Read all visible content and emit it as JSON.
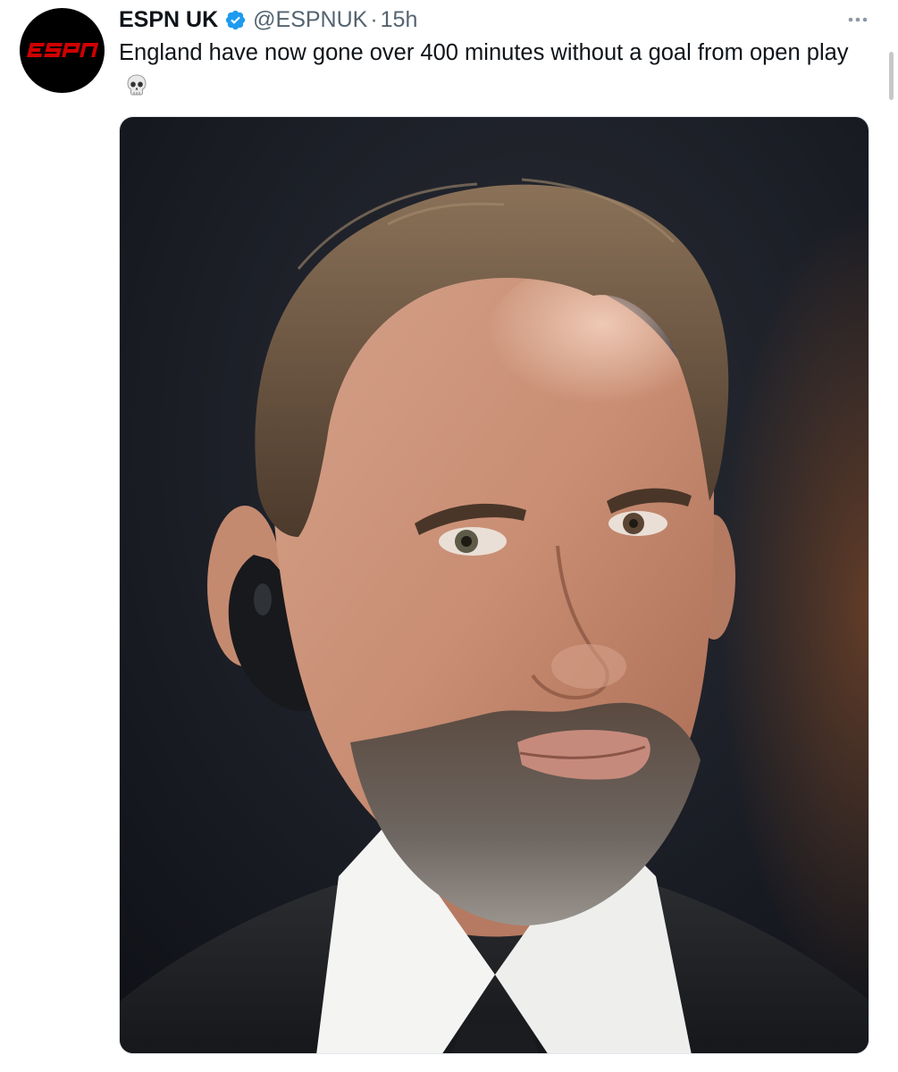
{
  "tweet": {
    "account": {
      "display_name": "ESPN UK",
      "handle": "@ESPNUK",
      "verified": true,
      "avatar_logo_text": "ESPN",
      "avatar_colors": {
        "background": "#000000",
        "logo": "#d00000"
      }
    },
    "separator": "·",
    "timestamp": "15h",
    "text": "England have now gone over 400 minutes without a goal from open play",
    "emoji": "💀",
    "icons": {
      "verified": "verified-badge-icon",
      "more": "more-options-icon",
      "emoji": "skull-icon"
    },
    "colors": {
      "verified_badge": "#1d9bf0",
      "secondary_text": "#536471",
      "primary_text": "#0f1419"
    }
  }
}
